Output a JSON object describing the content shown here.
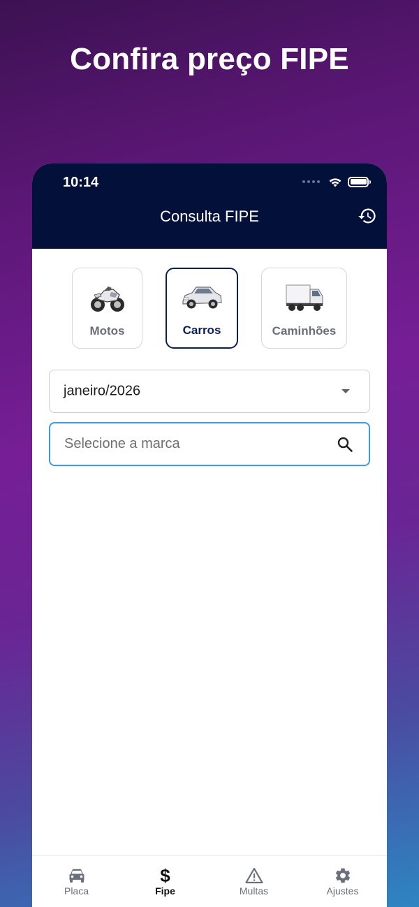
{
  "headline": "Confira preço FIPE",
  "status_bar": {
    "time": "10:14"
  },
  "header": {
    "title": "Consulta FIPE",
    "history_icon": "history-icon"
  },
  "vehicle_types": [
    {
      "label": "Motos",
      "icon": "motorcycle-icon",
      "selected": false
    },
    {
      "label": "Carros",
      "icon": "car-icon",
      "selected": true
    },
    {
      "label": "Caminhões",
      "icon": "truck-icon",
      "selected": false
    }
  ],
  "reference_month": {
    "value": "janeiro/2026"
  },
  "brand_search": {
    "placeholder": "Selecione a marca",
    "value": ""
  },
  "tabbar": {
    "items": [
      {
        "label": "Placa",
        "icon": "car-icon",
        "active": false
      },
      {
        "label": "Fipe",
        "icon": "dollar-icon",
        "active": true
      },
      {
        "label": "Multas",
        "icon": "warning-icon",
        "active": false
      },
      {
        "label": "Ajustes",
        "icon": "gear-icon",
        "active": false
      }
    ]
  },
  "colors": {
    "header_bg": "#03113a",
    "selected_border": "#0b1e55",
    "search_focus": "#3d9be0",
    "tab_inactive": "#6b6f7a"
  }
}
